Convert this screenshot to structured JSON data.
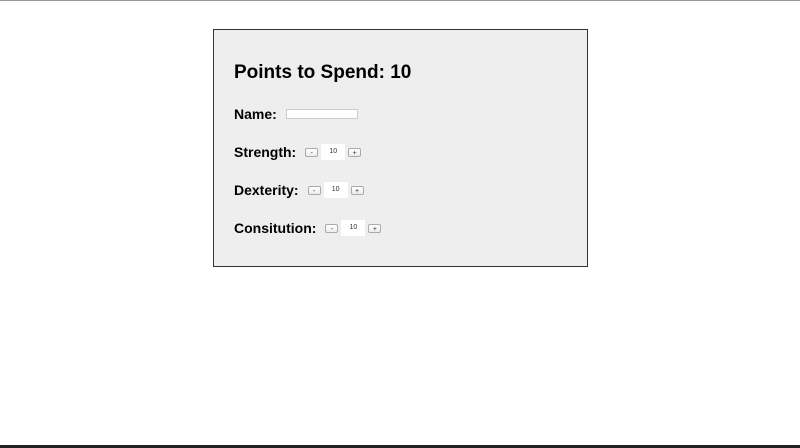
{
  "title": "Points to Spend: 10",
  "name": {
    "label": "Name:",
    "value": ""
  },
  "stats": [
    {
      "label": "Strength:",
      "value": "10",
      "minus": "-",
      "plus": "+"
    },
    {
      "label": "Dexterity:",
      "value": "10",
      "minus": "-",
      "plus": "+"
    },
    {
      "label": "Consitution:",
      "value": "10",
      "minus": "-",
      "plus": "+"
    }
  ]
}
